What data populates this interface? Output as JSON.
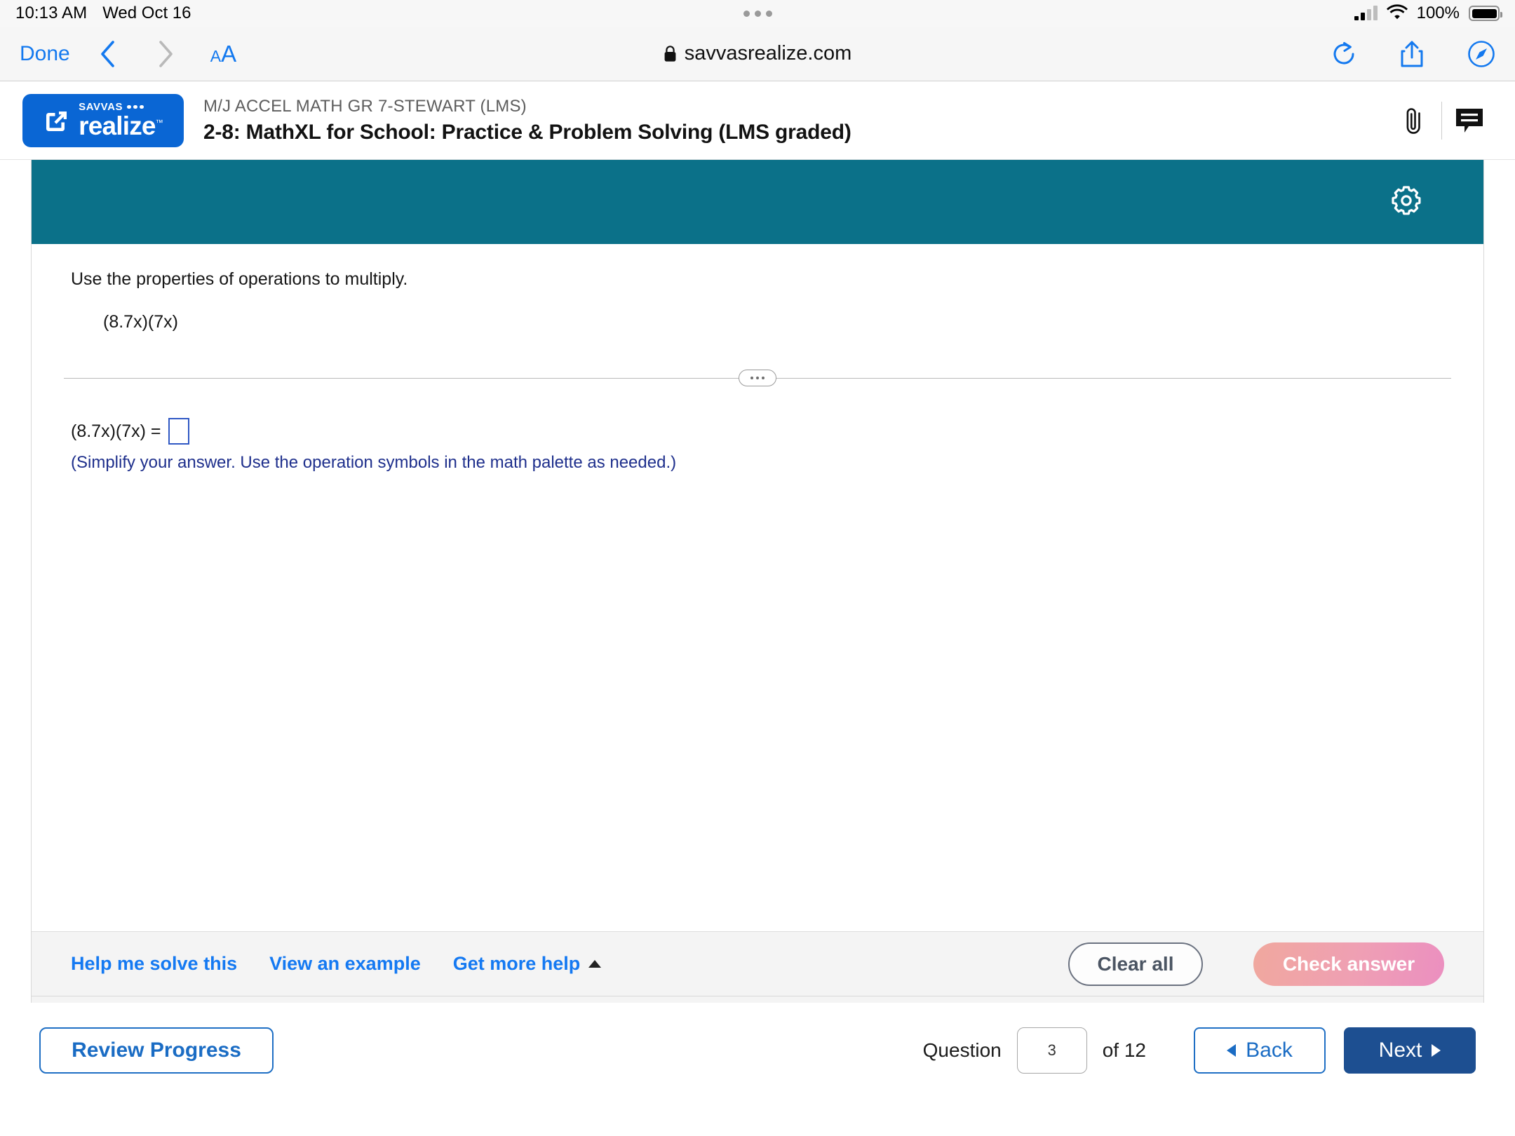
{
  "status_bar": {
    "time": "10:13 AM",
    "date": "Wed Oct 16",
    "battery_percent": "100%",
    "icons": [
      "signal-bars-icon",
      "wifi-icon",
      "battery-icon"
    ]
  },
  "browser": {
    "done_label": "Done",
    "back_icon": "chevron-left-icon",
    "forward_icon": "chevron-right-icon",
    "text_size_label_small": "A",
    "text_size_label_large": "A",
    "lock_icon": "lock-icon",
    "url": "savvasrealize.com",
    "reload_icon": "reload-icon",
    "share_icon": "share-icon",
    "compass_icon": "safari-compass-icon"
  },
  "app_header": {
    "logo_savvas": "SAVVAS",
    "logo_realize": "realize",
    "logo_tm": "™",
    "logo_mark_icon": "external-link-square-icon",
    "course_name": "M/J ACCEL MATH GR 7-STEWART (LMS)",
    "assignment_name": "2-8: MathXL for School: Practice & Problem Solving (LMS graded)",
    "attachment_icon": "paperclip-icon",
    "comment_icon": "comment-bubble-icon"
  },
  "exercise_toolbar": {
    "settings_icon": "gear-icon",
    "accent_color": "#0b7189"
  },
  "question": {
    "prompt": "Use the properties of operations to multiply.",
    "expression": "(8.7x)(7x)",
    "divider_icon": "ellipsis-pill-icon",
    "answer_prefix": "(8.7x)(7x) =",
    "answer_value": "",
    "answer_placeholder": "",
    "hint": "(Simplify your answer. Use the operation symbols in the math palette as needed.)",
    "hint_color": "#1e2f8c",
    "input_border_color": "#2f58c4"
  },
  "help_bar": {
    "links": [
      {
        "label": "Help me solve this",
        "icon": null
      },
      {
        "label": "View an example",
        "icon": null
      },
      {
        "label": "Get more help",
        "icon": "caret-up-icon"
      }
    ],
    "link_color": "#1479f2",
    "clear_all_label": "Clear all",
    "check_answer_label": "Check answer",
    "check_answer_state": "disabled",
    "check_answer_color": "#ef9fb4"
  },
  "bottom_nav": {
    "review_progress_label": "Review Progress",
    "question_label": "Question",
    "question_number": "3",
    "of_label": "of 12",
    "total_questions": "12",
    "back_label": "Back",
    "back_icon": "triangle-left-icon",
    "next_label": "Next",
    "next_icon": "triangle-right-icon",
    "next_color": "#1d4f91",
    "link_color": "#1a6cc4"
  }
}
